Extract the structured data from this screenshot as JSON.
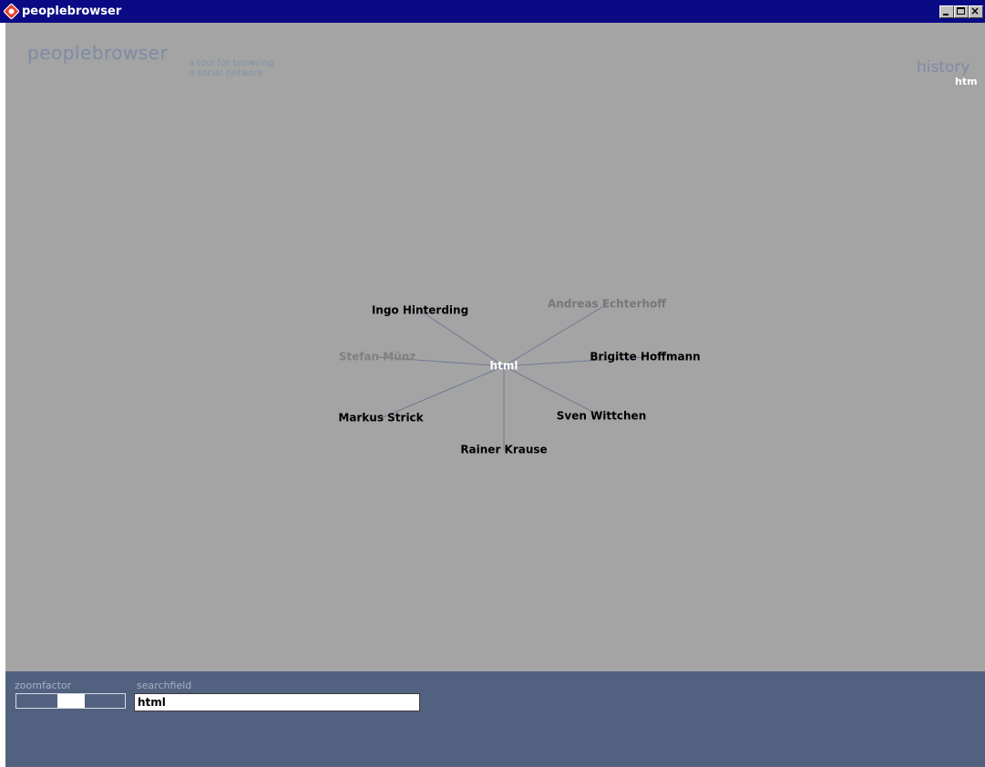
{
  "window": {
    "title": "peoplebrowser"
  },
  "header": {
    "brand": "peoplebrowser",
    "tagline_line1": "a tool for browsing",
    "tagline_line2": "a social network"
  },
  "history": {
    "title": "history",
    "items": [
      "htm"
    ]
  },
  "graph": {
    "center": {
      "label": "html",
      "color": "#ffffff"
    },
    "nodes": [
      {
        "label": "Ingo Hinterding",
        "color": "#000000"
      },
      {
        "label": "Andreas Echterhoff",
        "color": "#777777"
      },
      {
        "label": "Stefan Münz",
        "color": "#808080"
      },
      {
        "label": "Brigitte Hoffmann",
        "color": "#000000"
      },
      {
        "label": "Markus Strick",
        "color": "#000000"
      },
      {
        "label": "Sven Wittchen",
        "color": "#000000"
      },
      {
        "label": "Rainer Krause",
        "color": "#000000"
      }
    ],
    "edge_color": "#6e7a94"
  },
  "controls": {
    "zoom_label": "zoomfactor",
    "zoom_value": 0.5,
    "search_label": "searchfield",
    "search_value": "html"
  },
  "colors": {
    "titlebar": "#0a0a84",
    "canvas_bg": "#a4a4a4",
    "panel_bg": "#52617f",
    "brand_text": "#7f8aa5"
  }
}
